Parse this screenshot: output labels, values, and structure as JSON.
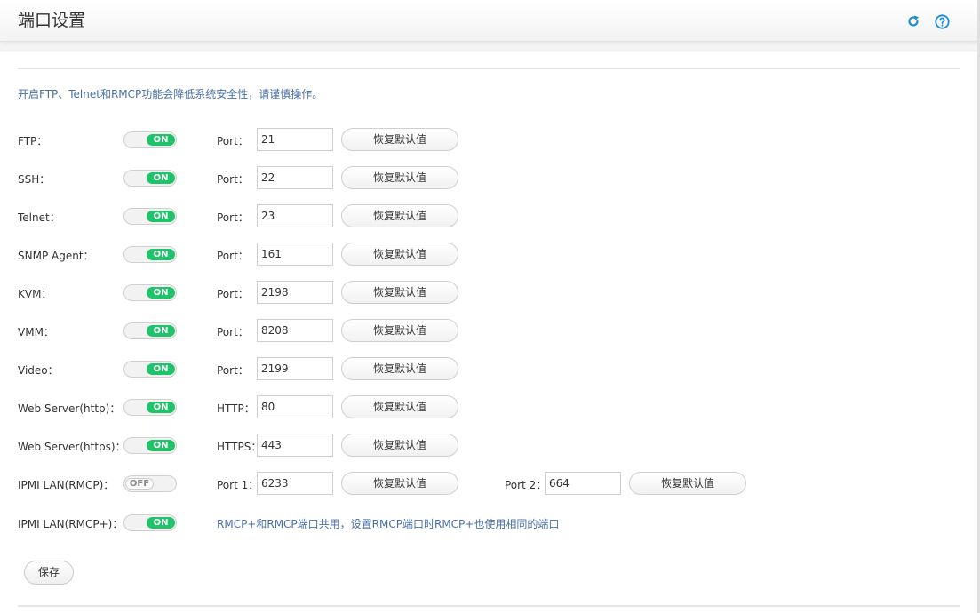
{
  "header": {
    "title": "端口设置",
    "icons": [
      "refresh-icon",
      "help-icon"
    ]
  },
  "notice": "开启FTP、Telnet和RMCP功能会降低系统安全性，请谨慎操作。",
  "rows": [
    {
      "label": "FTP：",
      "toggle": "ON",
      "port_label": "Port：",
      "port": "21",
      "restore": "恢复默认值"
    },
    {
      "label": "SSH：",
      "toggle": "ON",
      "port_label": "Port：",
      "port": "22",
      "restore": "恢复默认值"
    },
    {
      "label": "Telnet：",
      "toggle": "ON",
      "port_label": "Port：",
      "port": "23",
      "restore": "恢复默认值"
    },
    {
      "label": "SNMP Agent：",
      "toggle": "ON",
      "port_label": "Port：",
      "port": "161",
      "restore": "恢复默认值"
    },
    {
      "label": "KVM：",
      "toggle": "ON",
      "port_label": "Port：",
      "port": "2198",
      "restore": "恢复默认值"
    },
    {
      "label": "VMM：",
      "toggle": "ON",
      "port_label": "Port：",
      "port": "8208",
      "restore": "恢复默认值"
    },
    {
      "label": "Video：",
      "toggle": "ON",
      "port_label": "Port：",
      "port": "2199",
      "restore": "恢复默认值"
    },
    {
      "label": "Web Server(http)：",
      "toggle": "ON",
      "port_label": "HTTP：",
      "port": "80",
      "restore": "恢复默认值"
    },
    {
      "label": "Web Server(https)：",
      "toggle": "ON",
      "port_label": "HTTPS：",
      "port": "443",
      "restore": "恢复默认值"
    },
    {
      "label": "IPMI LAN(RMCP)：",
      "toggle": "OFF",
      "port_label": "Port 1：",
      "port": "6233",
      "restore": "恢复默认值",
      "port2_label": "Port 2：",
      "port2": "664",
      "restore2": "恢复默认值"
    },
    {
      "label": "IPMI LAN(RMCP+)：",
      "toggle": "ON",
      "note": "RMCP+和RMCP端口共用，设置RMCP端口时RMCP+也使用相同的端口"
    }
  ],
  "save_label": "保存",
  "colors": {
    "toggle_on": "#1ec36a",
    "accent": "#1f8ad6",
    "notice": "#4a6fa5"
  }
}
